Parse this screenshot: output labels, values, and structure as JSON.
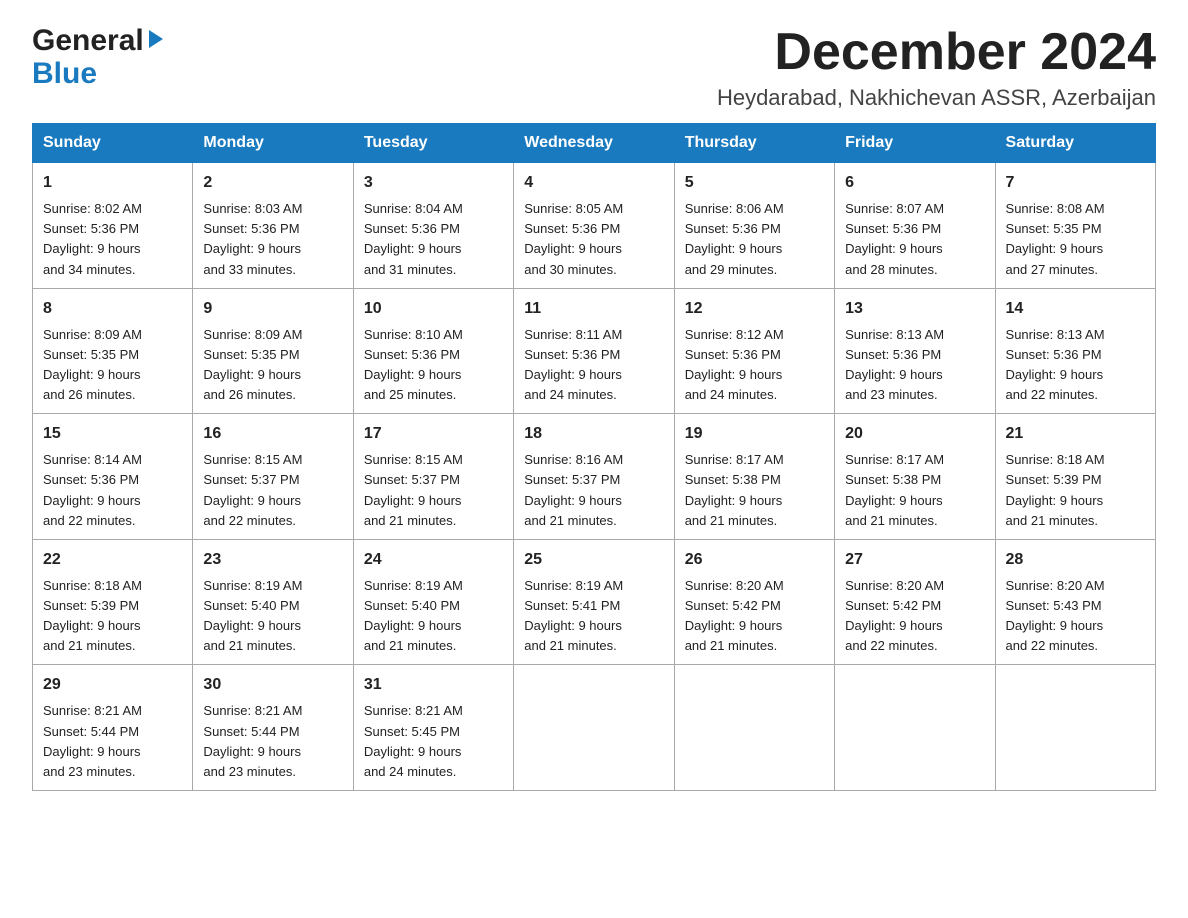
{
  "logo": {
    "general": "General",
    "blue": "Blue"
  },
  "title": "December 2024",
  "subtitle": "Heydarabad, Nakhichevan ASSR, Azerbaijan",
  "days_of_week": [
    "Sunday",
    "Monday",
    "Tuesday",
    "Wednesday",
    "Thursday",
    "Friday",
    "Saturday"
  ],
  "weeks": [
    [
      {
        "day": "1",
        "sunrise": "8:02 AM",
        "sunset": "5:36 PM",
        "daylight": "9 hours and 34 minutes."
      },
      {
        "day": "2",
        "sunrise": "8:03 AM",
        "sunset": "5:36 PM",
        "daylight": "9 hours and 33 minutes."
      },
      {
        "day": "3",
        "sunrise": "8:04 AM",
        "sunset": "5:36 PM",
        "daylight": "9 hours and 31 minutes."
      },
      {
        "day": "4",
        "sunrise": "8:05 AM",
        "sunset": "5:36 PM",
        "daylight": "9 hours and 30 minutes."
      },
      {
        "day": "5",
        "sunrise": "8:06 AM",
        "sunset": "5:36 PM",
        "daylight": "9 hours and 29 minutes."
      },
      {
        "day": "6",
        "sunrise": "8:07 AM",
        "sunset": "5:36 PM",
        "daylight": "9 hours and 28 minutes."
      },
      {
        "day": "7",
        "sunrise": "8:08 AM",
        "sunset": "5:35 PM",
        "daylight": "9 hours and 27 minutes."
      }
    ],
    [
      {
        "day": "8",
        "sunrise": "8:09 AM",
        "sunset": "5:35 PM",
        "daylight": "9 hours and 26 minutes."
      },
      {
        "day": "9",
        "sunrise": "8:09 AM",
        "sunset": "5:35 PM",
        "daylight": "9 hours and 26 minutes."
      },
      {
        "day": "10",
        "sunrise": "8:10 AM",
        "sunset": "5:36 PM",
        "daylight": "9 hours and 25 minutes."
      },
      {
        "day": "11",
        "sunrise": "8:11 AM",
        "sunset": "5:36 PM",
        "daylight": "9 hours and 24 minutes."
      },
      {
        "day": "12",
        "sunrise": "8:12 AM",
        "sunset": "5:36 PM",
        "daylight": "9 hours and 24 minutes."
      },
      {
        "day": "13",
        "sunrise": "8:13 AM",
        "sunset": "5:36 PM",
        "daylight": "9 hours and 23 minutes."
      },
      {
        "day": "14",
        "sunrise": "8:13 AM",
        "sunset": "5:36 PM",
        "daylight": "9 hours and 22 minutes."
      }
    ],
    [
      {
        "day": "15",
        "sunrise": "8:14 AM",
        "sunset": "5:36 PM",
        "daylight": "9 hours and 22 minutes."
      },
      {
        "day": "16",
        "sunrise": "8:15 AM",
        "sunset": "5:37 PM",
        "daylight": "9 hours and 22 minutes."
      },
      {
        "day": "17",
        "sunrise": "8:15 AM",
        "sunset": "5:37 PM",
        "daylight": "9 hours and 21 minutes."
      },
      {
        "day": "18",
        "sunrise": "8:16 AM",
        "sunset": "5:37 PM",
        "daylight": "9 hours and 21 minutes."
      },
      {
        "day": "19",
        "sunrise": "8:17 AM",
        "sunset": "5:38 PM",
        "daylight": "9 hours and 21 minutes."
      },
      {
        "day": "20",
        "sunrise": "8:17 AM",
        "sunset": "5:38 PM",
        "daylight": "9 hours and 21 minutes."
      },
      {
        "day": "21",
        "sunrise": "8:18 AM",
        "sunset": "5:39 PM",
        "daylight": "9 hours and 21 minutes."
      }
    ],
    [
      {
        "day": "22",
        "sunrise": "8:18 AM",
        "sunset": "5:39 PM",
        "daylight": "9 hours and 21 minutes."
      },
      {
        "day": "23",
        "sunrise": "8:19 AM",
        "sunset": "5:40 PM",
        "daylight": "9 hours and 21 minutes."
      },
      {
        "day": "24",
        "sunrise": "8:19 AM",
        "sunset": "5:40 PM",
        "daylight": "9 hours and 21 minutes."
      },
      {
        "day": "25",
        "sunrise": "8:19 AM",
        "sunset": "5:41 PM",
        "daylight": "9 hours and 21 minutes."
      },
      {
        "day": "26",
        "sunrise": "8:20 AM",
        "sunset": "5:42 PM",
        "daylight": "9 hours and 21 minutes."
      },
      {
        "day": "27",
        "sunrise": "8:20 AM",
        "sunset": "5:42 PM",
        "daylight": "9 hours and 22 minutes."
      },
      {
        "day": "28",
        "sunrise": "8:20 AM",
        "sunset": "5:43 PM",
        "daylight": "9 hours and 22 minutes."
      }
    ],
    [
      {
        "day": "29",
        "sunrise": "8:21 AM",
        "sunset": "5:44 PM",
        "daylight": "9 hours and 23 minutes."
      },
      {
        "day": "30",
        "sunrise": "8:21 AM",
        "sunset": "5:44 PM",
        "daylight": "9 hours and 23 minutes."
      },
      {
        "day": "31",
        "sunrise": "8:21 AM",
        "sunset": "5:45 PM",
        "daylight": "9 hours and 24 minutes."
      },
      null,
      null,
      null,
      null
    ]
  ],
  "labels": {
    "sunrise": "Sunrise:",
    "sunset": "Sunset:",
    "daylight": "Daylight:"
  }
}
